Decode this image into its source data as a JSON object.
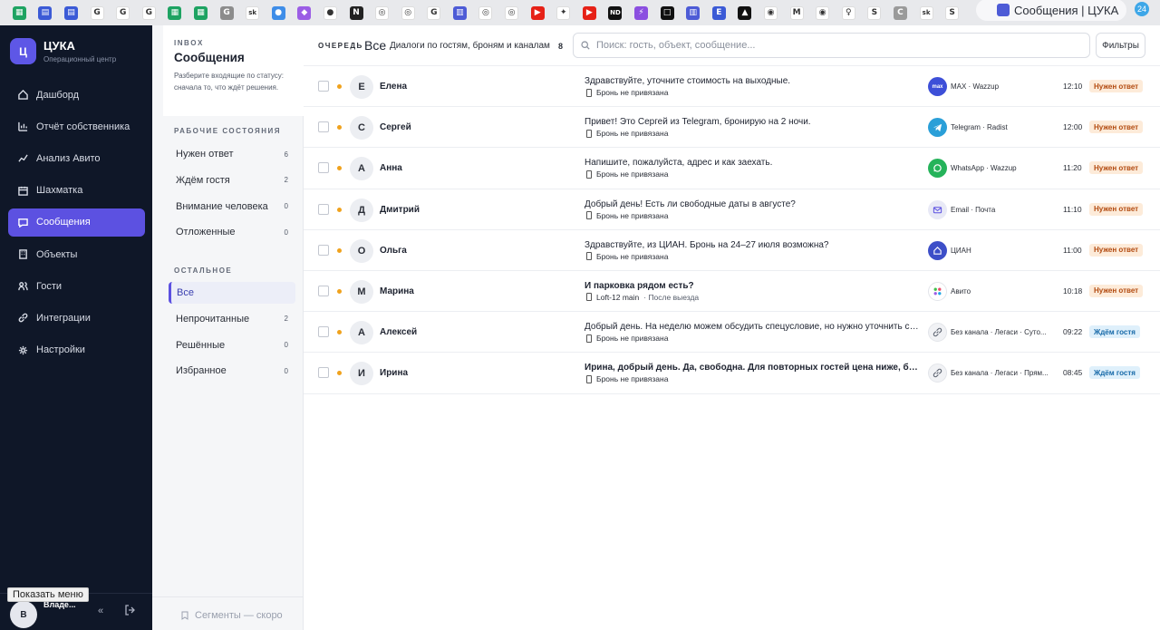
{
  "browser": {
    "active_tab_title": "Сообщения | ЦУКА",
    "notification_count": "24",
    "favicons": [
      {
        "icon": "sheets-icon",
        "color": "#1ea362",
        "glyph": "▦"
      },
      {
        "icon": "calendar-icon",
        "color": "#3b5ad6",
        "glyph": "▤"
      },
      {
        "icon": "calendar-icon",
        "color": "#3b5ad6",
        "glyph": "▤"
      },
      {
        "icon": "google-icon",
        "color": "#ffffff",
        "glyph": "G"
      },
      {
        "icon": "google-icon",
        "color": "#ffffff",
        "glyph": "G"
      },
      {
        "icon": "google-icon",
        "color": "#ffffff",
        "glyph": "G"
      },
      {
        "icon": "sheets-icon",
        "color": "#1ea362",
        "glyph": "▦"
      },
      {
        "icon": "sheets-icon",
        "color": "#1ea362",
        "glyph": "▦"
      },
      {
        "icon": "grammar-icon",
        "color": "#8c8c8c",
        "glyph": "G"
      },
      {
        "icon": "sk-icon",
        "color": "#ffffff",
        "glyph": "sk"
      },
      {
        "icon": "drop-icon",
        "color": "#3e8de8",
        "glyph": "●"
      },
      {
        "icon": "gradient-icon",
        "color": "#9b5de5",
        "glyph": "◆"
      },
      {
        "icon": "github-icon",
        "color": "#ffffff",
        "glyph": "●"
      },
      {
        "icon": "notion-icon",
        "color": "#222222",
        "glyph": "N"
      },
      {
        "icon": "compass-icon",
        "color": "#ffffff",
        "glyph": "◎"
      },
      {
        "icon": "compass-icon",
        "color": "#ffffff",
        "glyph": "◎"
      },
      {
        "icon": "google-icon",
        "color": "#ffffff",
        "glyph": "G"
      },
      {
        "icon": "dashboard-icon",
        "color": "#4d5bd6",
        "glyph": "▥"
      },
      {
        "icon": "compass-icon",
        "color": "#ffffff",
        "glyph": "◎"
      },
      {
        "icon": "compass-icon",
        "color": "#ffffff",
        "glyph": "◎"
      },
      {
        "icon": "youtube-icon",
        "color": "#e62117",
        "glyph": "▶"
      },
      {
        "icon": "bird-icon",
        "color": "#ffffff",
        "glyph": "✦"
      },
      {
        "icon": "youtube-icon",
        "color": "#e62117",
        "glyph": "▶"
      },
      {
        "icon": "nd-icon",
        "color": "#111111",
        "glyph": "ND"
      },
      {
        "icon": "lightning-icon",
        "color": "#8b4fe0",
        "glyph": "⚡"
      },
      {
        "icon": "square-icon",
        "color": "#111111",
        "glyph": "□"
      },
      {
        "icon": "dashboard-icon",
        "color": "#4d5bd6",
        "glyph": "▥"
      },
      {
        "icon": "e-icon",
        "color": "#3b5ad6",
        "glyph": "E"
      },
      {
        "icon": "triangle-icon",
        "color": "#111111",
        "glyph": "▲"
      },
      {
        "icon": "globe-icon",
        "color": "#ffffff",
        "glyph": "◉"
      },
      {
        "icon": "gmail-icon",
        "color": "#ffffff",
        "glyph": "M"
      },
      {
        "icon": "globe-icon",
        "color": "#ffffff",
        "glyph": "◉"
      },
      {
        "icon": "pin-icon",
        "color": "#ffffff",
        "glyph": "♀"
      },
      {
        "icon": "s-icon",
        "color": "#ffffff",
        "glyph": "S"
      },
      {
        "icon": "c-icon",
        "color": "#9a9a9a",
        "glyph": "C"
      },
      {
        "icon": "sk-icon",
        "color": "#ffffff",
        "glyph": "sk"
      },
      {
        "icon": "s-icon",
        "color": "#ffffff",
        "glyph": "S"
      }
    ]
  },
  "sidebar": {
    "logo_letter": "Ц",
    "app_name": "ЦУКА",
    "app_subtitle": "Операционный центр",
    "items": [
      {
        "label": "Дашборд",
        "icon": "home-icon",
        "active": false
      },
      {
        "label": "Отчёт собственника",
        "icon": "bar-chart-icon",
        "active": false
      },
      {
        "label": "Анализ Авито",
        "icon": "trend-icon",
        "active": false
      },
      {
        "label": "Шахматка",
        "icon": "calendar-icon",
        "active": false
      },
      {
        "label": "Сообщения",
        "icon": "chat-icon",
        "active": true
      },
      {
        "label": "Объекты",
        "icon": "building-icon",
        "active": false
      },
      {
        "label": "Гости",
        "icon": "users-icon",
        "active": false
      },
      {
        "label": "Интеграции",
        "icon": "link-icon",
        "active": false
      },
      {
        "label": "Настройки",
        "icon": "gear-icon",
        "active": false
      }
    ],
    "user_initial": "В",
    "user_name": "Владе...",
    "tooltip": "Показать меню",
    "accent": "#5c51e1"
  },
  "panel": {
    "kicker": "INBOX",
    "title": "Сообщения",
    "description": "Разберите входящие по статусу: сначала то, что ждёт решения.",
    "work_section": "РАБОЧИЕ СОСТОЯНИЯ",
    "work_items": [
      {
        "label": "Нужен ответ",
        "count": "6"
      },
      {
        "label": "Ждём гостя",
        "count": "2"
      },
      {
        "label": "Внимание человека",
        "count": "0"
      },
      {
        "label": "Отложенные",
        "count": "0"
      }
    ],
    "other_section": "ОСТАЛЬНОЕ",
    "other_items": [
      {
        "label": "Все",
        "count": "",
        "selected": true
      },
      {
        "label": "Непрочитанные",
        "count": "2"
      },
      {
        "label": "Решённые",
        "count": "0"
      },
      {
        "label": "Избранное",
        "count": "0"
      }
    ],
    "segments": "Сегменты — скоро"
  },
  "main": {
    "queue_kicker": "ОЧЕРЕДЬ",
    "queue_title": "Все",
    "queue_desc": "Диалоги по гостям, броням и каналам",
    "queue_count": "8",
    "search_placeholder": "Поиск: гость, объект, сообщение...",
    "filters_label": "Фильтры",
    "rows": [
      {
        "initial": "Е",
        "name": "Елена",
        "message": "Здравствуйте, уточните стоимость на выходные.",
        "bold": false,
        "booking": "Бронь не привязана",
        "booking_extra": "",
        "channel_icon": "max-icon",
        "channel_color": "#3d4fd8",
        "channel": "MAX · Wazzup",
        "time": "12:10",
        "status": "Нужен ответ",
        "status_kind": "need"
      },
      {
        "initial": "С",
        "name": "Сергей",
        "message": "Привет! Это Сергей из Telegram, бронирую на 2 ночи.",
        "bold": false,
        "booking": "Бронь не привязана",
        "booking_extra": "",
        "channel_icon": "telegram-icon",
        "channel_color": "#2a9fd8",
        "channel": "Telegram · Radist",
        "time": "12:00",
        "status": "Нужен ответ",
        "status_kind": "need"
      },
      {
        "initial": "А",
        "name": "Анна",
        "message": "Напишите, пожалуйста, адрес и как заехать.",
        "bold": false,
        "booking": "Бронь не привязана",
        "booking_extra": "",
        "channel_icon": "whatsapp-icon",
        "channel_color": "#25b35a",
        "channel": "WhatsApp · Wazzup",
        "time": "11:20",
        "status": "Нужен ответ",
        "status_kind": "need"
      },
      {
        "initial": "Д",
        "name": "Дмитрий",
        "message": "Добрый день! Есть ли свободные даты в августе?",
        "bold": false,
        "booking": "Бронь не привязана",
        "booking_extra": "",
        "channel_icon": "mail-icon",
        "channel_color": "#e8e9f6",
        "channel": "Email · Почта",
        "time": "11:10",
        "status": "Нужен ответ",
        "status_kind": "need"
      },
      {
        "initial": "О",
        "name": "Ольга",
        "message": "Здравствуйте, из ЦИАН. Бронь на 24–27 июля возможна?",
        "bold": false,
        "booking": "Бронь не привязана",
        "booking_extra": "",
        "channel_icon": "cian-icon",
        "channel_color": "#3d4fc8",
        "channel": "ЦИАН",
        "time": "11:00",
        "status": "Нужен ответ",
        "status_kind": "need"
      },
      {
        "initial": "М",
        "name": "Марина",
        "message": "И парковка рядом есть?",
        "bold": true,
        "booking": "Loft-12 main",
        "booking_extra": "· После выезда",
        "channel_icon": "avito-icon",
        "channel_color": "#ffffff",
        "channel": "Авито",
        "time": "10:18",
        "status": "Нужен ответ",
        "status_kind": "need"
      },
      {
        "initial": "А",
        "name": "Алексей",
        "message": "Добрый день. На неделю можем обсудить спецусловие, но нужно уточнить со...",
        "bold": false,
        "booking": "Бронь не привязана",
        "booking_extra": "",
        "channel_icon": "link-icon",
        "channel_color": "#f1f2f5",
        "channel": "Без канала · Легаси · Суто...",
        "time": "09:22",
        "status": "Ждём гостя",
        "status_kind": "wait"
      },
      {
        "initial": "И",
        "name": "Ирина",
        "message": "Ирина, добрый день. Да, свободна. Для повторных гостей цена ниже, без ...",
        "bold": true,
        "booking": "Бронь не привязана",
        "booking_extra": "",
        "channel_icon": "link-icon",
        "channel_color": "#f1f2f5",
        "channel": "Без канала · Легаси · Прям...",
        "time": "08:45",
        "status": "Ждём гостя",
        "status_kind": "wait"
      }
    ]
  }
}
